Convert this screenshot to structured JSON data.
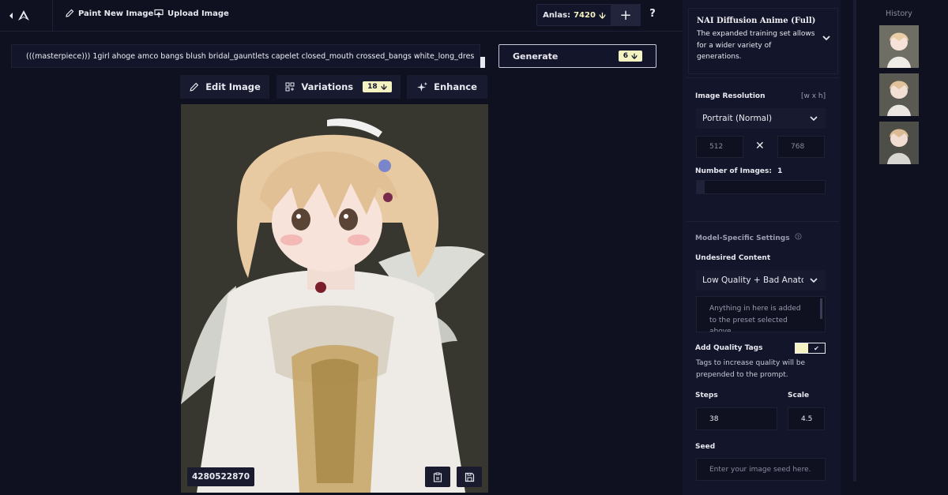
{
  "toolbar": {
    "paint_new_image": "Paint New Image",
    "upload_image": "Upload Image",
    "anlas_label": "Anlas:",
    "anlas_value": "7420",
    "plus": "+",
    "help": "?"
  },
  "prompt": {
    "text": "(((masterpiece))) 1girl ahoge amco bangs blush bridal_gauntlets capelet closed_mouth crossed_bangs white_long_dres",
    "generate_label": "Generate",
    "generate_cost": "6"
  },
  "actions": {
    "edit_image": "Edit Image",
    "variations": "Variations",
    "variations_cost": "18",
    "enhance": "Enhance"
  },
  "image": {
    "seed": "4280522870"
  },
  "model": {
    "title": "NAI Diffusion Anime (Full)",
    "description": "The expanded training set allows for a wider variety of generations."
  },
  "resolution": {
    "label": "Image Resolution",
    "hint": "[w x h]",
    "preset": "Portrait (Normal)",
    "width": "512",
    "height": "768",
    "times": "✕",
    "num_images_label": "Number of Images:",
    "num_images_value": "1",
    "num_images_fraction": 0.06
  },
  "model_settings": {
    "label": "Model-Specific Settings",
    "undesired_label": "Undesired Content",
    "undesired_preset": "Low Quality + Bad Anatomy",
    "undesired_placeholder": "Anything in here is added to the preset selected above.",
    "quality_tags_label": "Add Quality Tags",
    "quality_tags_enabled": true,
    "quality_tags_help": "Tags to increase quality will be prepended to the prompt.",
    "steps_label": "Steps",
    "steps_value": "38",
    "scale_label": "Scale",
    "scale_value": "4.5",
    "seed_label": "Seed",
    "seed_placeholder": "Enter your image seed here."
  },
  "history": {
    "title": "History"
  },
  "colors": {
    "background": "#0f1020",
    "panel": "#13152a",
    "accent": "#f5f3c2"
  }
}
